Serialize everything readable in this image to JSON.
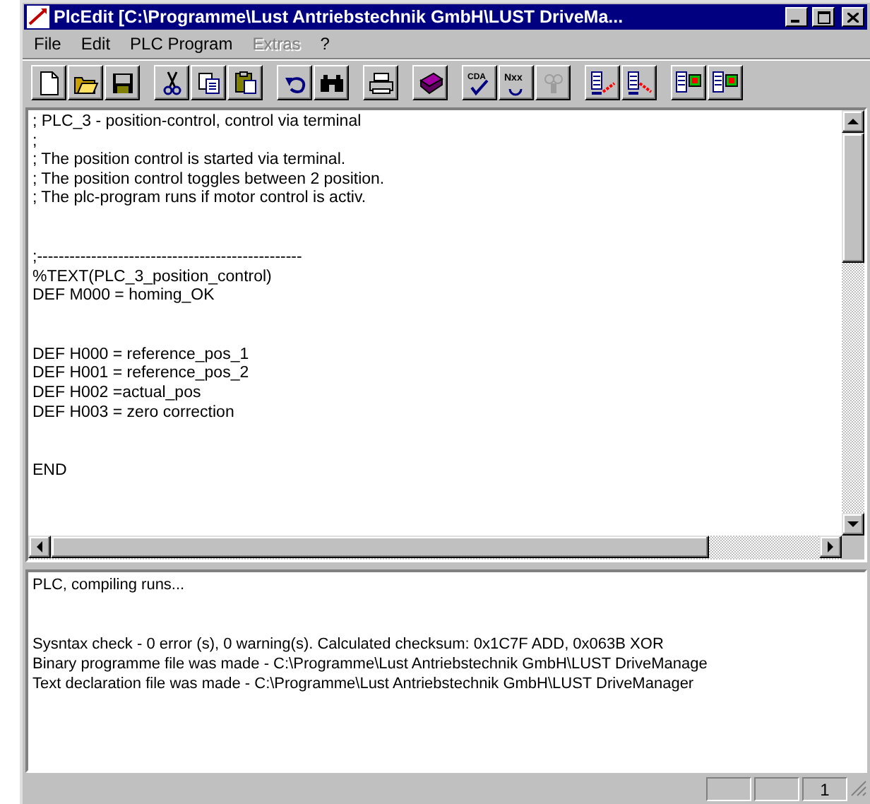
{
  "window": {
    "title": "PlcEdit [C:\\Programme\\Lust Antriebstechnik GmbH\\LUST DriveMa..."
  },
  "menu": [
    {
      "label": "File",
      "disabled": false
    },
    {
      "label": "Edit",
      "disabled": false
    },
    {
      "label": "PLC Program",
      "disabled": false
    },
    {
      "label": "Extras",
      "disabled": true
    },
    {
      "label": "?",
      "disabled": false
    }
  ],
  "toolbar": [
    [
      {
        "kind": "new",
        "disabled": false
      },
      {
        "kind": "open",
        "disabled": false
      },
      {
        "kind": "save",
        "disabled": false
      }
    ],
    [
      {
        "kind": "cut",
        "disabled": false
      },
      {
        "kind": "copy",
        "disabled": false
      },
      {
        "kind": "paste",
        "disabled": false
      }
    ],
    [
      {
        "kind": "undo",
        "disabled": false
      },
      {
        "kind": "find",
        "disabled": false
      }
    ],
    [
      {
        "kind": "print",
        "disabled": false
      }
    ],
    [
      {
        "kind": "book",
        "disabled": false
      }
    ],
    [
      {
        "kind": "check",
        "label": "CDA",
        "disabled": false
      },
      {
        "kind": "next",
        "label": "Nxx",
        "disabled": false
      },
      {
        "kind": "link",
        "disabled": true
      }
    ],
    [
      {
        "kind": "upload",
        "disabled": false
      },
      {
        "kind": "download",
        "disabled": false
      }
    ],
    [
      {
        "kind": "compare",
        "disabled": false
      },
      {
        "kind": "compare",
        "disabled": false
      }
    ]
  ],
  "editor": {
    "blocks": [
      [
        "; PLC_3 - position-control, control via terminal",
        ";",
        "; The position control is started via terminal.",
        "; The position control toggles between 2 position.",
        "; The plc-program runs if motor control is activ."
      ],
      [
        ";-------------------------------------------------",
        "%TEXT(PLC_3_position_control)",
        "DEF M000 = homing_OK"
      ],
      [
        "DEF H000 = reference_pos_1",
        "DEF H001 = reference_pos_2",
        "DEF H002 =actual_pos",
        "DEF H003 = zero correction"
      ],
      [
        "END"
      ]
    ]
  },
  "output": {
    "blocks": [
      [
        "PLC, compiling runs..."
      ],
      [
        "Sysntax check - 0 error (s), 0 warning(s). Calculated checksum: 0x1C7F ADD, 0x063B XOR",
        "Binary programme file was made - C:\\Programme\\Lust Antriebstechnik GmbH\\LUST DriveManage",
        "Text declaration file was made - C:\\Programme\\Lust Antriebstechnik GmbH\\LUST DriveManager"
      ]
    ]
  },
  "status_bar": {
    "line": "1"
  }
}
